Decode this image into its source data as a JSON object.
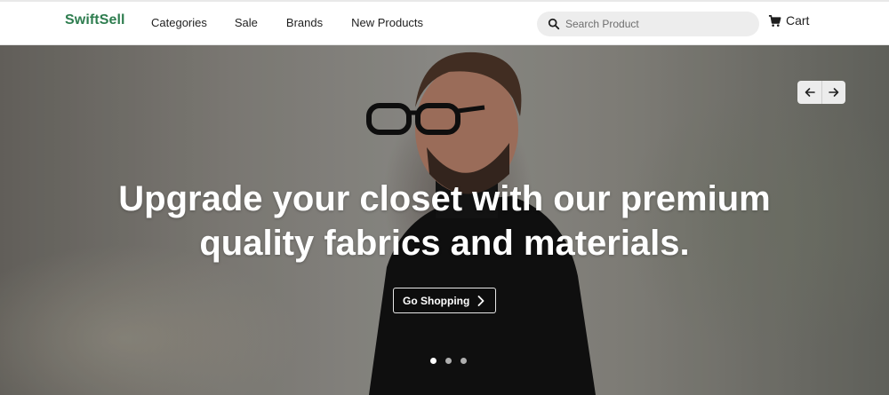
{
  "brand": {
    "name": "SwiftSell",
    "color": "#2e7d4f"
  },
  "nav": {
    "items": [
      {
        "label": "Categories"
      },
      {
        "label": "Sale"
      },
      {
        "label": "Brands"
      },
      {
        "label": "New Products"
      }
    ]
  },
  "search": {
    "placeholder": "Search Product",
    "value": "",
    "icon": "search-icon"
  },
  "cart": {
    "label": "Cart",
    "icon": "cart-icon"
  },
  "hero": {
    "title_line1": "Upgrade your closet with our premium",
    "title_line2": "quality fabrics and materials.",
    "cta_label": "Go Shopping",
    "cta_icon": "chevron-right-icon",
    "prev_icon": "arrow-left-icon",
    "next_icon": "arrow-right-icon",
    "slides_total": 3,
    "active_slide": 1
  }
}
